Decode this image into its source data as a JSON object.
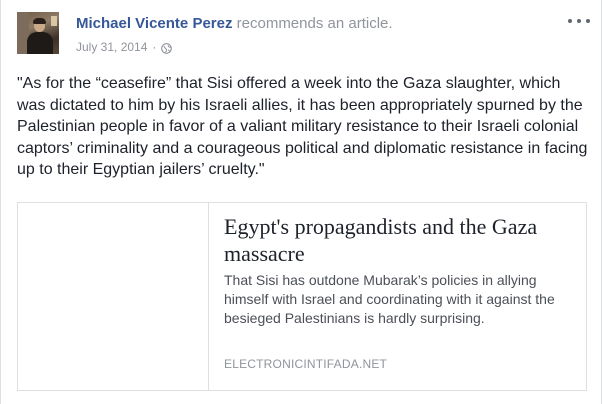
{
  "post": {
    "author": "Michael Vicente Perez",
    "action": "recommends an article.",
    "date": "July 31, 2014",
    "separator": "·",
    "privacy_icon": "globe-icon",
    "more_icon": "more-options-icon",
    "text": "\"As for the “ceasefire” that Sisi offered a week into the Gaza slaughter, which was dictated to him by his Israeli allies, it has been appropriately spurned by the Palestinian people in favor of a valiant military resistance to their Israeli colonial captors’ criminality and a courageous political and diplomatic resistance in facing up to their Egyptian jailers’ cruelty.\""
  },
  "link": {
    "title": "Egypt's propagandists and the Gaza massacre",
    "description": "That Sisi has outdone Mubarak’s policies in allying himself with Israel and coordinating with it against the besieged Palestinians is hardly surprising.",
    "domain": "ELECTRONICINTIFADA.NET"
  },
  "colors": {
    "author": "#365899",
    "muted": "#90949c",
    "text": "#1d2129",
    "border": "#dddfe2"
  }
}
